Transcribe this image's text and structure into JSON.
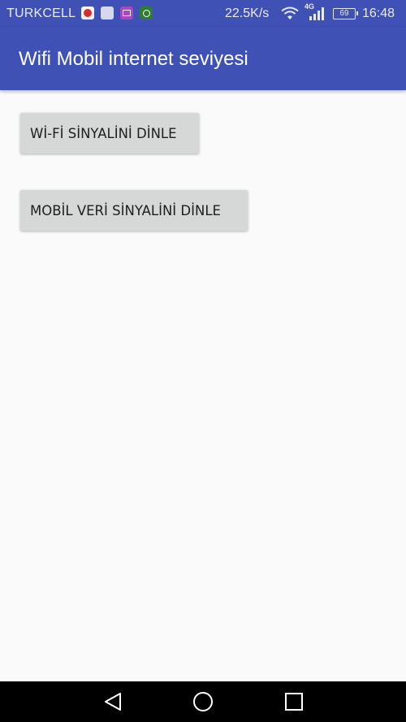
{
  "status_bar": {
    "carrier": "TURKCELL",
    "network_speed": "22.5K/s",
    "network_type": "4G",
    "battery": "69",
    "time": "16:48",
    "notification_icons": [
      "umbrella-app-icon",
      "grey-app-icon",
      "gallery-icon",
      "whatsapp-icon"
    ]
  },
  "app_bar": {
    "title": "Wifi Mobil internet seviyesi",
    "color": "#3f51b5"
  },
  "main": {
    "wifi_button_label": "Wİ-Fİ SİNYALİNİ DİNLE",
    "mobile_button_label": "MOBİL VERİ SİNYALİNİ DİNLE"
  },
  "nav_bar": {
    "icons": [
      "back-icon",
      "home-icon",
      "recents-icon"
    ]
  }
}
